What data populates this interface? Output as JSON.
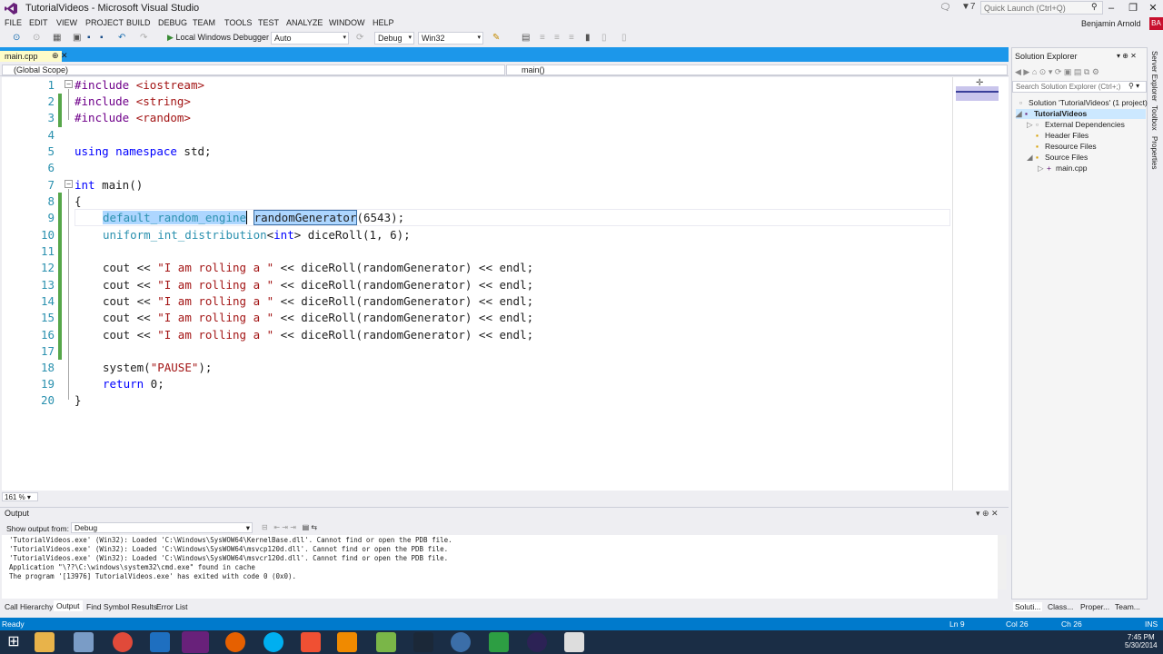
{
  "window": {
    "title": "TutorialVideos - Microsoft Visual Studio",
    "notifications": "7",
    "quick_launch_placeholder": "Quick Launch (Ctrl+Q)",
    "user": "Benjamin Arnold",
    "avatar": "BA",
    "controls": [
      "–",
      "❐",
      "✕"
    ]
  },
  "menu": [
    "FILE",
    "EDIT",
    "VIEW",
    "PROJECT",
    "BUILD",
    "DEBUG",
    "TEAM",
    "TOOLS",
    "TEST",
    "ANALYZE",
    "WINDOW",
    "HELP"
  ],
  "toolbar": {
    "run_label": "Local Windows Debugger",
    "auto_combo": "Auto",
    "config_combo": "Debug",
    "platform_combo": "Win32"
  },
  "editor": {
    "tab_label": "main.cpp",
    "scope_left": "(Global Scope)",
    "scope_right": "main()",
    "zoom": "161 %",
    "line_numbers": [
      "1",
      "2",
      "3",
      "4",
      "5",
      "6",
      "7",
      "8",
      "9",
      "10",
      "11",
      "12",
      "13",
      "14",
      "15",
      "16",
      "17",
      "18",
      "19",
      "20"
    ],
    "code": {
      "l1_pp": "#include",
      "l1_rest": " <iostream>",
      "l2_pp": "#include",
      "l2_rest": " <string>",
      "l3_pp": "#include",
      "l3_rest": " <random>",
      "l5_kw1": "using",
      "l5_kw2": "namespace",
      "l5_rest": " std;",
      "l7_kw": "int",
      "l7_rest": " main()",
      "l8": "{",
      "l9_type": "default_random_engine",
      "l9_var": "randomGenerator",
      "l9_rest": "(6543);",
      "l10_type": "uniform_int_distribution",
      "l10_lt": "<",
      "l10_kw": "int",
      "l10_rest": "> diceRoll(1, 6);",
      "cout_pre": "cout << ",
      "cout_str": "\"I am rolling a \"",
      "cout_post": " << diceRoll(randomGenerator) << endl;",
      "l18_pre": "system(",
      "l18_str": "\"PAUSE\"",
      "l18_post": ");",
      "l19_kw": "return",
      "l19_rest": " 0;",
      "l20": "}"
    }
  },
  "solution_explorer": {
    "title": "Solution Explorer",
    "search_placeholder": "Search Solution Explorer (Ctrl+;)",
    "tree": [
      "Solution 'TutorialVideos' (1 project)",
      "TutorialVideos",
      "External Dependencies",
      "Header Files",
      "Resource Files",
      "Source Files",
      "main.cpp"
    ],
    "bottom_tabs": [
      "Soluti...",
      "Class...",
      "Proper...",
      "Team..."
    ]
  },
  "side_tabs": [
    "Server Explorer",
    "Toolbox",
    "Properties"
  ],
  "output": {
    "title": "Output",
    "show_label": "Show output from:",
    "source": "Debug",
    "lines": [
      "'TutorialVideos.exe' (Win32): Loaded 'C:\\Windows\\SysWOW64\\KernelBase.dll'. Cannot find or open the PDB file.",
      "'TutorialVideos.exe' (Win32): Loaded 'C:\\Windows\\SysWOW64\\msvcp120d.dll'. Cannot find or open the PDB file.",
      "'TutorialVideos.exe' (Win32): Loaded 'C:\\Windows\\SysWOW64\\msvcr120d.dll'. Cannot find or open the PDB file.",
      "Application \"\\??\\C:\\windows\\system32\\cmd.exe\" found in cache",
      "The program '[13976] TutorialVideos.exe' has exited with code 0 (0x0)."
    ]
  },
  "bottom_tabs": [
    "Call Hierarchy",
    "Output",
    "Find Symbol Results",
    "Error List"
  ],
  "status": {
    "state": "Ready",
    "ln": "Ln 9",
    "col": "Col 26",
    "ch": "Ch 26",
    "mode": "INS"
  },
  "taskbar": {
    "time": "7:45 PM",
    "date": "5/30/2014",
    "apps": [
      "windows-start",
      "file-explorer",
      "file-manager",
      "chrome",
      "outlook",
      "visual-studio",
      "firefox",
      "skype",
      "git",
      "vlc",
      "notepad-plus",
      "steam",
      "chat",
      "windows-apps",
      "eclipse",
      "console"
    ]
  }
}
